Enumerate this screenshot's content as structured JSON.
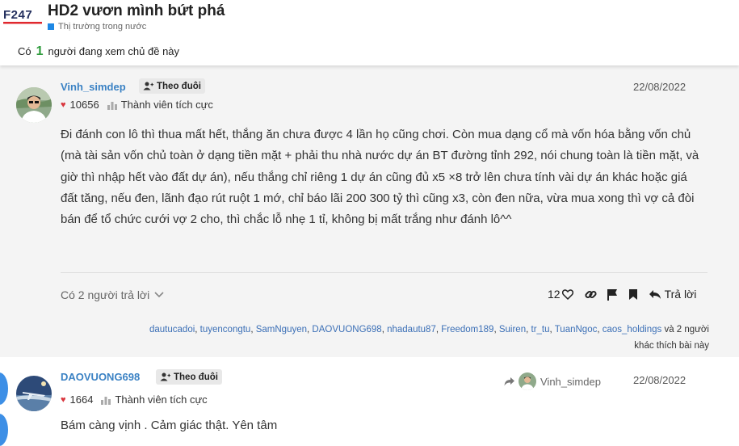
{
  "header": {
    "logo_text": "F247",
    "title": "HD2 vươn mình bứt phá",
    "category": "Thị trường trong nước",
    "category_color": "#1e88e5",
    "viewers_prefix": "Có",
    "viewers_count": "1",
    "viewers_suffix": "người đang xem chủ đề này"
  },
  "posts": [
    {
      "username": "Vinh_simdep",
      "follow_label": "Theo đuôi",
      "reputation": "10656",
      "rank": "Thành viên tích cực",
      "date": "22/08/2022",
      "content": "Đi đánh con lô thì thua mất hết, thắng ăn chưa được 4 lần họ cũng chơi. Còn mua dạng cổ mà vốn hóa bằng vốn chủ (mà tài sản vốn chủ toàn ở dạng tiền mặt + phải thu nhà nước dự án BT đường tỉnh 292, nói chung toàn là tiền mặt, và giờ thì nhập hết vào đất dự án), nếu thắng chỉ riêng 1 dự án cũng đủ x5 ×8 trở lên chưa tính vài dự án khác hoặc giá đất tăng, nếu đen, lãnh đạo rút ruột 1 mớ, chỉ báo lãi 200 300 tỷ thì cũng x3, còn đen nữa, vừa mua xong thì vợ cả đòi bán để tổ chức cưới vợ 2 cho, thì chắc lỗ nhẹ 1 tỉ, không bị mất trắng như đánh lô^^",
      "replies_label": "Có 2 người trả lời",
      "like_count": "12",
      "reply_label": "Trả lời",
      "likers": [
        "dautucadoi",
        "tuyencongtu",
        "SamNguyen",
        "DAOVUONG698",
        "nhadautu87",
        "Freedom189",
        "Suiren",
        "tr_tu",
        "TuanNgoc",
        "caos_holdings"
      ],
      "likers_suffix_a": "và 2 người",
      "likers_suffix_b": "khác thích bài này"
    },
    {
      "username": "DAOVUONG698",
      "follow_label": "Theo đuôi",
      "reputation": "1664",
      "rank": "Thành viên tích cực",
      "date": "22/08/2022",
      "reply_to": "Vinh_simdep",
      "content": "Bám càng vịnh . Cảm giác thật. Yên tâm"
    }
  ],
  "colors": {
    "link": "#3b82c4",
    "heart": "#d9363e",
    "viewer_count": "#2e9b3c",
    "side_circle": "#3d8fe6"
  }
}
